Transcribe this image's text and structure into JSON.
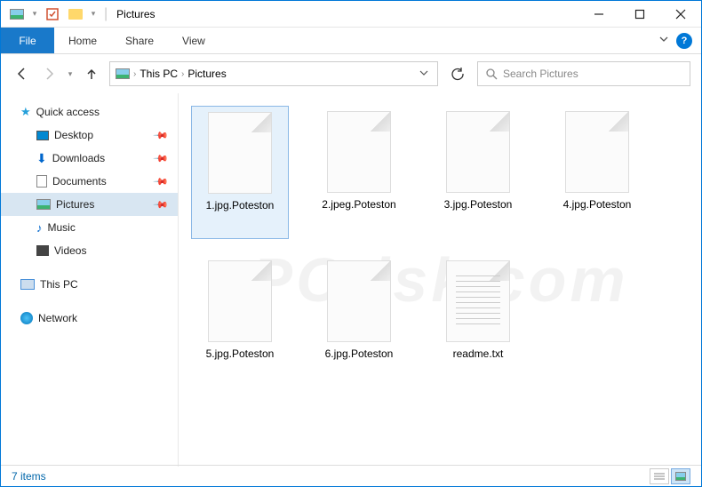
{
  "window": {
    "title": "Pictures"
  },
  "tabs": {
    "file": "File",
    "home": "Home",
    "share": "Share",
    "view": "View"
  },
  "breadcrumb": {
    "root": "This PC",
    "current": "Pictures"
  },
  "search": {
    "placeholder": "Search Pictures"
  },
  "sidebar": {
    "quick_access": "Quick access",
    "items": [
      {
        "label": "Desktop",
        "icon": "desktop"
      },
      {
        "label": "Downloads",
        "icon": "downloads"
      },
      {
        "label": "Documents",
        "icon": "documents"
      },
      {
        "label": "Pictures",
        "icon": "pictures"
      },
      {
        "label": "Music",
        "icon": "music"
      },
      {
        "label": "Videos",
        "icon": "videos"
      }
    ],
    "this_pc": "This PC",
    "network": "Network"
  },
  "files": [
    {
      "name": "1.jpg.Poteston",
      "type": "blank"
    },
    {
      "name": "2.jpeg.Poteston",
      "type": "blank"
    },
    {
      "name": "3.jpg.Poteston",
      "type": "blank"
    },
    {
      "name": "4.jpg.Poteston",
      "type": "blank"
    },
    {
      "name": "5.jpg.Poteston",
      "type": "blank"
    },
    {
      "name": "6.jpg.Poteston",
      "type": "blank"
    },
    {
      "name": "readme.txt",
      "type": "txt"
    }
  ],
  "status": {
    "count": "7 items"
  }
}
